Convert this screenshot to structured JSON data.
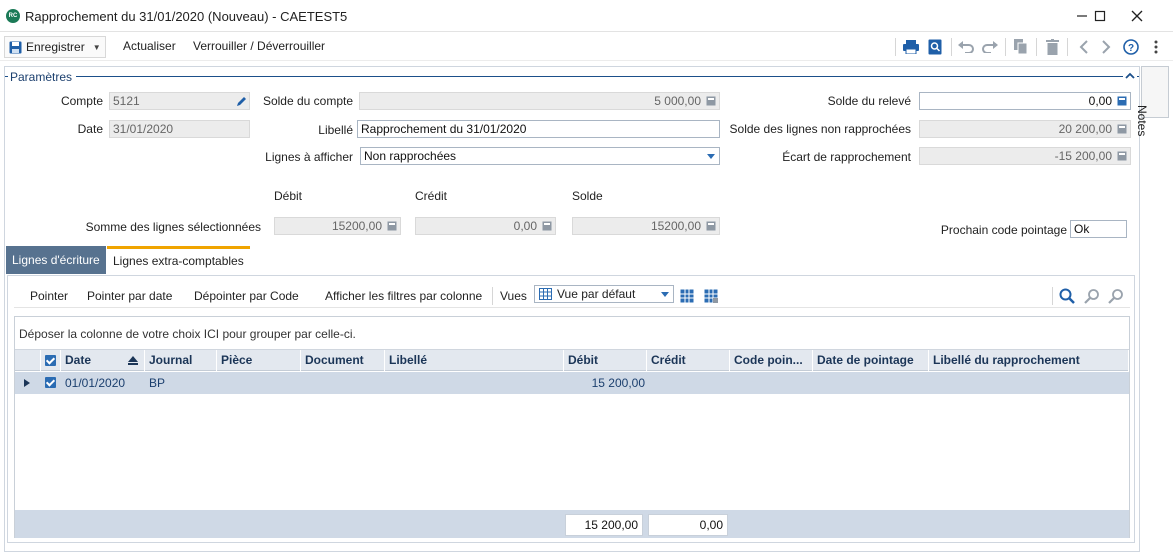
{
  "window": {
    "badge": "RC",
    "title": "Rapprochement du 31/01/2020 (Nouveau) - CAETEST5"
  },
  "toolbar": {
    "save_label": "Enregistrer",
    "refresh_label": "Actualiser",
    "lock_label": "Verrouiller / Déverrouiller"
  },
  "section": {
    "title": "Paramètres"
  },
  "params": {
    "compte_label": "Compte",
    "compte_value": "5121",
    "date_label": "Date",
    "date_value": "31/01/2020",
    "solde_compte_label": "Solde du compte",
    "solde_compte_value": "5 000,00",
    "libelle_label": "Libellé",
    "libelle_value": "Rapprochement du 31/01/2020",
    "lignes_label": "Lignes à afficher",
    "lignes_value": "Non rapprochées",
    "solde_releve_label": "Solde du relevé",
    "solde_releve_value": "0,00",
    "solde_non_rapp_label": "Solde des lignes non rapprochées",
    "solde_non_rapp_value": "20 200,00",
    "ecart_label": "Écart de rapprochement",
    "ecart_value": "-15 200,00"
  },
  "somme": {
    "debit_header": "Débit",
    "credit_header": "Crédit",
    "solde_header": "Solde",
    "label": "Somme des lignes sélectionnées",
    "debit_value": "15200,00",
    "credit_value": "0,00",
    "solde_value": "15200,00",
    "prochain_label": "Prochain code pointage",
    "prochain_value": "Ok"
  },
  "tabs": {
    "ecriture": "Lignes d'écriture",
    "extra": "Lignes extra-comptables"
  },
  "grid_toolbar": {
    "pointer": "Pointer",
    "pointer_date": "Pointer par date",
    "depointer_code": "Dépointer par Code",
    "filtres": "Afficher les filtres par colonne",
    "vues_label": "Vues",
    "vue_value": "Vue par défaut"
  },
  "grid": {
    "group_hint": "Déposer la colonne de votre choix ICI pour grouper par celle-ci.",
    "columns": {
      "date": "Date",
      "journal": "Journal",
      "piece": "Pièce",
      "document": "Document",
      "libelle": "Libellé",
      "debit": "Débit",
      "credit": "Crédit",
      "code": "Code poin...",
      "date_pointage": "Date de pointage",
      "libelle_rapp": "Libellé du rapprochement"
    },
    "rows": [
      {
        "date": "01/01/2020",
        "journal": "BP",
        "piece": "",
        "document": "",
        "libelle": "",
        "debit": "15 200,00",
        "credit": "",
        "code": "",
        "date_pointage": "",
        "libelle_rapp": ""
      }
    ],
    "totals": {
      "debit": "15 200,00",
      "credit": "0,00"
    }
  },
  "notes": {
    "label": "Notes"
  }
}
